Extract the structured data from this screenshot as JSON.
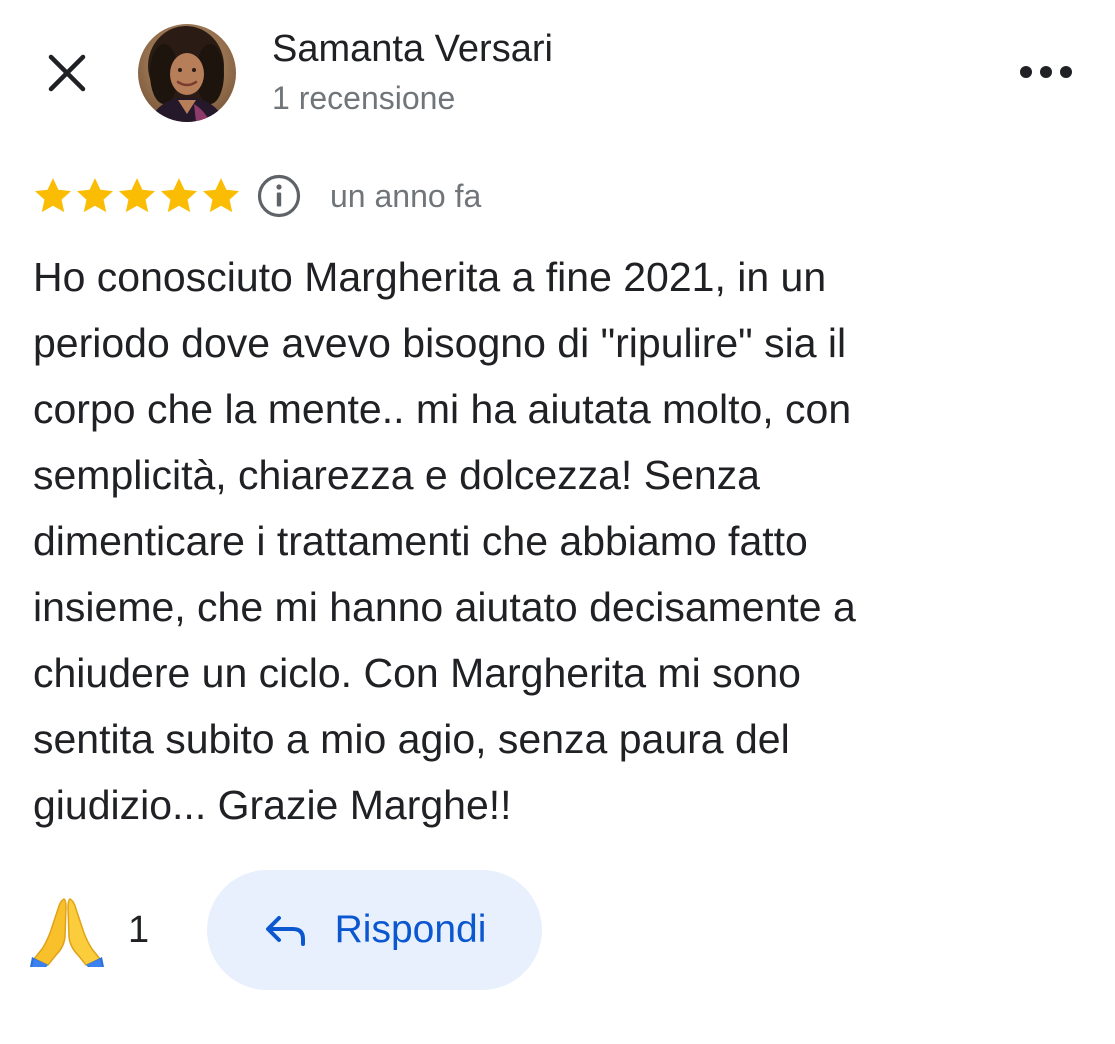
{
  "header": {
    "close_icon": "close-icon",
    "more_icon": "more-horizontal-icon",
    "reviewer": {
      "name": "Samanta Versari",
      "meta": "1 recensione"
    }
  },
  "review": {
    "rating": 5,
    "rating_max": 5,
    "star_color": "#fbbc04",
    "info_icon": "info-icon",
    "date": "un anno fa",
    "lines": [
      "Ho conosciuto Margherita a fine 2021, in un",
      "periodo dove avevo bisogno di \"ripulire\" sia il",
      "corpo che la mente.. mi ha aiutata molto, con",
      "semplicità, chiarezza e dolcezza! Senza",
      "dimenticare i trattamenti che abbiamo fatto",
      "insieme, che mi hanno aiutato decisamente a",
      "chiudere un ciclo. Con Margherita mi sono",
      "sentita subito a mio agio, senza paura del",
      "giudizio... Grazie Marghe!!"
    ]
  },
  "actions": {
    "reaction_icon": "folded-hands-icon",
    "reaction_count": "1",
    "reply_icon": "reply-arrow-icon",
    "reply_label": "Rispondi"
  },
  "colors": {
    "reply_bg": "#e8f0fe",
    "reply_text": "#0b57d0",
    "secondary_text": "#70757a"
  }
}
